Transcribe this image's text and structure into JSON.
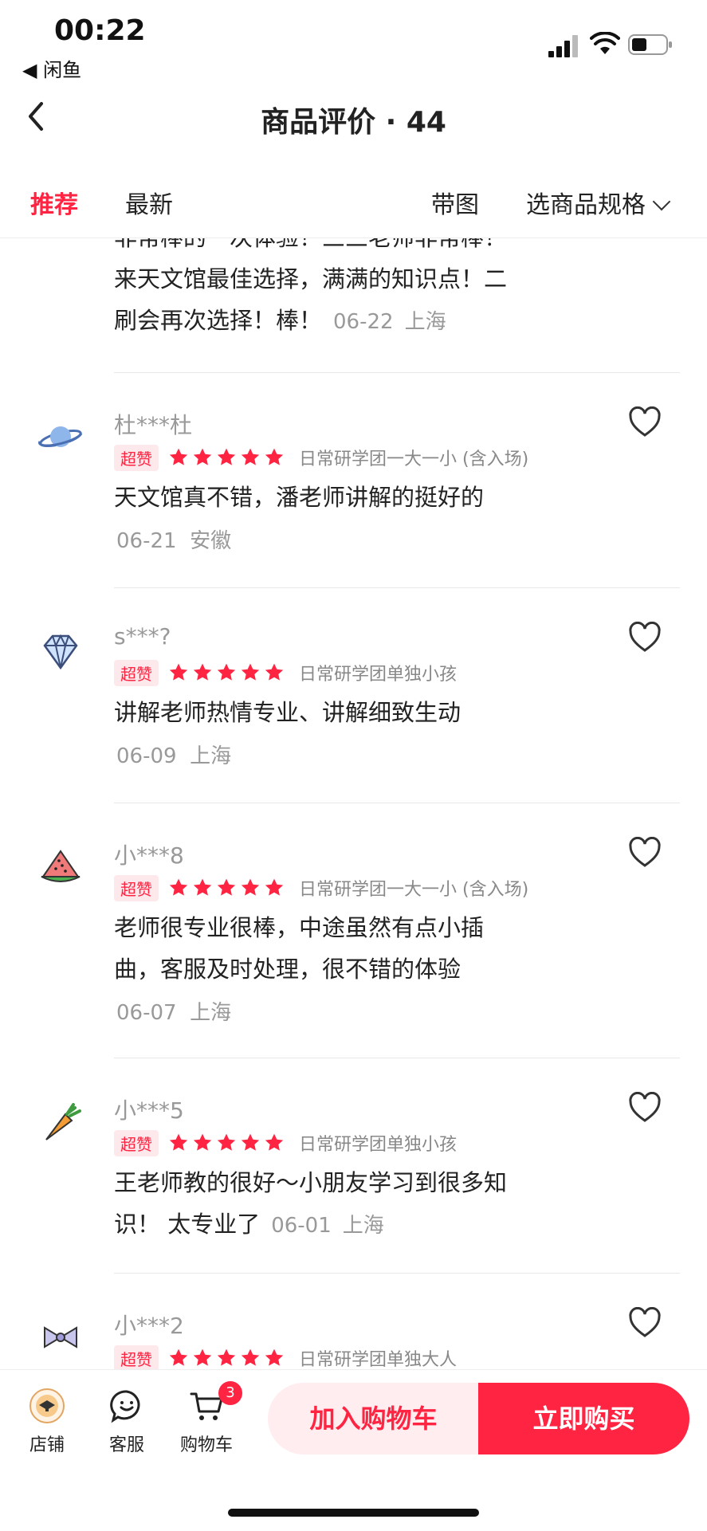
{
  "status": {
    "time": "00:22",
    "back_app": "◀ 闲鱼"
  },
  "header": {
    "title": "商品评价 · 44"
  },
  "tabs": [
    {
      "label": "推荐",
      "active": true
    },
    {
      "label": "最新"
    },
    {
      "label": "带图"
    },
    {
      "label": "选商品规格"
    }
  ],
  "partial_review": {
    "line1": "非常棒的一次体验！三三老师非常棒！",
    "line2": "来天文馆最佳选择，满满的知识点！二",
    "line3": "刷会再次选择！棒！",
    "date": "06-22",
    "location": "上海"
  },
  "reviews": [
    {
      "avatar_icon": "planet-icon",
      "name": "杜***杜",
      "badge": "超赞",
      "rating": 5,
      "spec": "日常研学团一大一小 (含入场)",
      "text_lines": [
        "天文馆真不错，潘老师讲解的挺好的"
      ],
      "date": "06-21",
      "location": "安徽"
    },
    {
      "avatar_icon": "diamond-icon",
      "name": "s***?",
      "badge": "超赞",
      "rating": 5,
      "spec": "日常研学团单独小孩",
      "text_lines": [
        "讲解老师热情专业、讲解细致生动"
      ],
      "date": "06-09",
      "location": "上海"
    },
    {
      "avatar_icon": "watermelon-icon",
      "name": "小***8",
      "badge": "超赞",
      "rating": 5,
      "spec": "日常研学团一大一小 (含入场)",
      "text_lines": [
        "老师很专业很棒，中途虽然有点小插",
        "曲，客服及时处理，很不错的体验"
      ],
      "date": "06-07",
      "location": "上海"
    },
    {
      "avatar_icon": "carrot-icon",
      "name": "小***5",
      "badge": "超赞",
      "rating": 5,
      "spec": "日常研学团单独小孩",
      "text_lines": [
        "王老师教的很好～小朋友学习到很多知",
        "识！ 太专业了"
      ],
      "date": "06-01",
      "location": "上海"
    },
    {
      "avatar_icon": "bow-icon",
      "name": "小***2",
      "badge": "超赞",
      "rating": 5,
      "spec": "日常研学团单独大人",
      "text_lines": [],
      "date": "",
      "location": ""
    }
  ],
  "bottom_bar": {
    "shop": "店铺",
    "service": "客服",
    "cart": "购物车",
    "cart_count": "3",
    "add_to_cart": "加入购物车",
    "buy_now": "立即购买"
  },
  "colors": {
    "accent": "#ff2442",
    "accent_light": "#ffedf0"
  }
}
